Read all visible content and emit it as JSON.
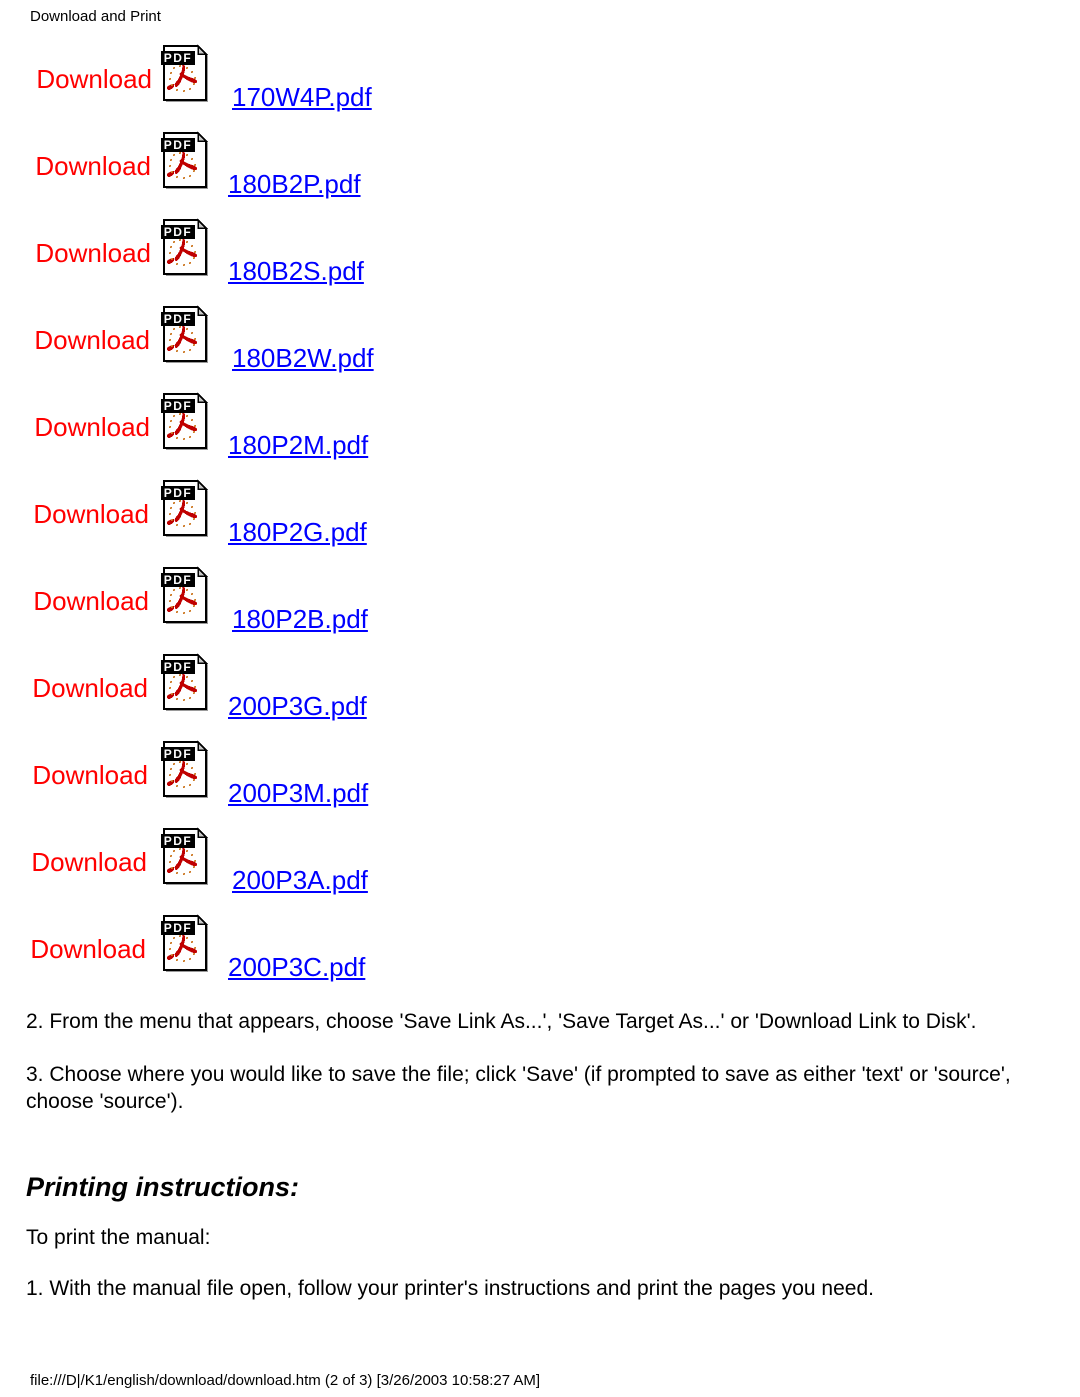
{
  "header": {
    "title": "Download and Print"
  },
  "downloads": {
    "label": "Download",
    "icon_name": "pdf-file-icon",
    "icon_badge": "PDF",
    "items": [
      {
        "label": "Download",
        "file": "170W4P.pdf"
      },
      {
        "label": "Download",
        "file": "180B2P.pdf"
      },
      {
        "label": "Download",
        "file": "180B2S.pdf"
      },
      {
        "label": "Download",
        "file": "180B2W.pdf"
      },
      {
        "label": "Download",
        "file": "180P2M.pdf"
      },
      {
        "label": "Download",
        "file": "180P2G.pdf"
      },
      {
        "label": "Download",
        "file": "180P2B.pdf"
      },
      {
        "label": "Download",
        "file": "200P3G.pdf"
      },
      {
        "label": "Download",
        "file": "200P3M.pdf"
      },
      {
        "label": "Download",
        "file": "200P3A.pdf"
      },
      {
        "label": "Download",
        "file": "200P3C.pdf"
      }
    ]
  },
  "instructions": {
    "step2": "2. From the menu that appears, choose 'Save Link As...', 'Save Target As...' or 'Download Link to Disk'.",
    "step3": "3. Choose where you would like to save the file; click 'Save' (if prompted to save as either 'text' or 'source', choose 'source')."
  },
  "printing": {
    "title": "Printing instructions:",
    "intro": "To print the manual:",
    "step1": "1. With the manual file open, follow your printer's instructions and print the pages you need."
  },
  "footer": {
    "path": "file:///D|/K1/english/download/download.htm (2 of 3) [3/26/2003 10:58:27 AM]"
  },
  "colors": {
    "download_label": "#ff0000",
    "link": "#0000ff",
    "text": "#000000",
    "background": "#ffffff"
  }
}
